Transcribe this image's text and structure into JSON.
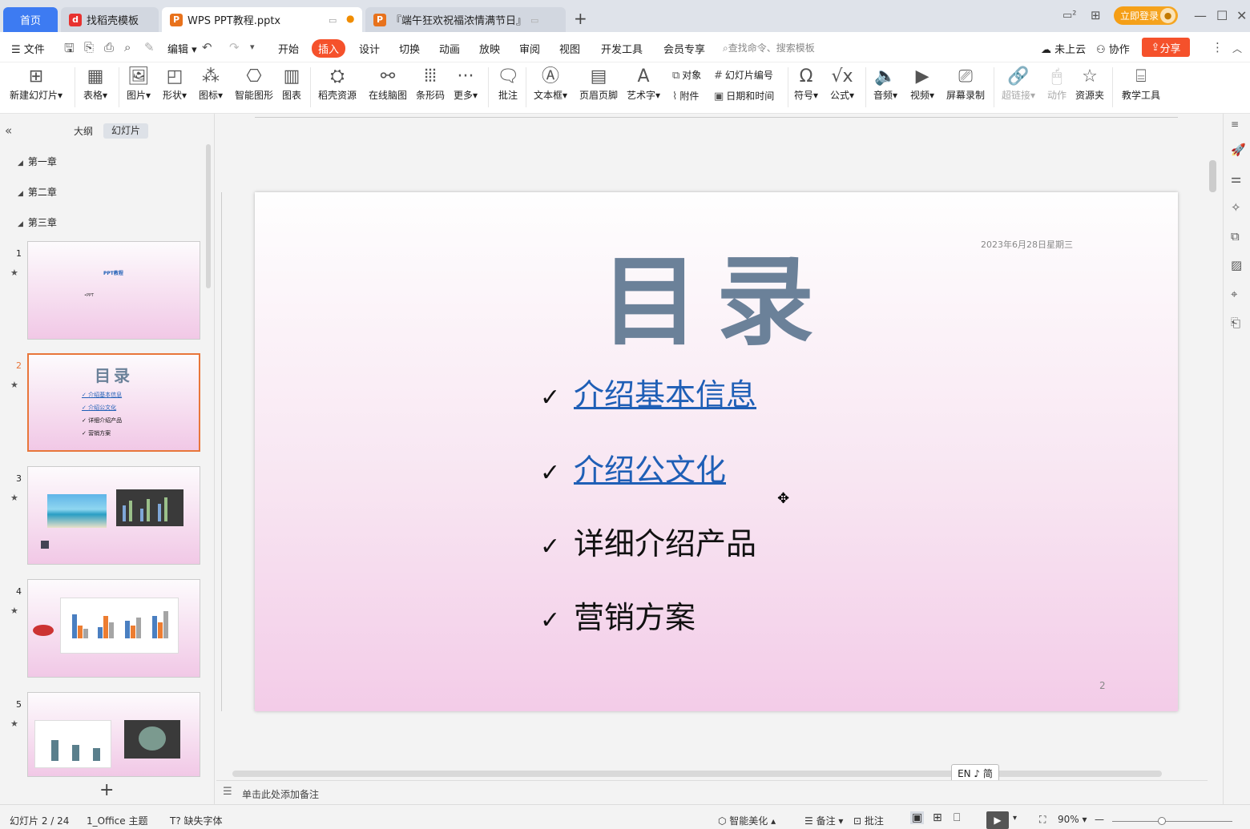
{
  "tabs": {
    "home": "首页",
    "template": "找稻壳模板",
    "ppt": "WPS PPT教程.pptx",
    "festival": "『端午狂欢祝福浓情满节日』"
  },
  "titlebar": {
    "login": "立即登录"
  },
  "menu": {
    "file": "文件",
    "edit": "编辑",
    "items": [
      "开始",
      "插入",
      "设计",
      "切换",
      "动画",
      "放映",
      "审阅",
      "视图",
      "开发工具",
      "会员专享"
    ],
    "search_placeholder": "查找命令、搜索模板",
    "cloud": "未上云",
    "collab": "协作",
    "share": "分享"
  },
  "ribbon": {
    "new_slide": "新建幻灯片",
    "table": "表格",
    "picture": "图片",
    "shape": "形状",
    "icon": "图标",
    "smartart": "智能图形",
    "chart": "图表",
    "docer": "稻壳资源",
    "mindmap": "在线脑图",
    "barcode": "条形码",
    "more": "更多",
    "comment": "批注",
    "textbox": "文本框",
    "header_footer": "页眉页脚",
    "wordart": "艺术字",
    "object": "对象",
    "attachment": "附件",
    "slide_number": "幻灯片编号",
    "datetime": "日期和时间",
    "symbol": "符号",
    "formula": "公式",
    "audio": "音频",
    "video": "视频",
    "screen_record": "屏幕录制",
    "hyperlink": "超链接",
    "action": "动作",
    "resource_folder": "资源夹",
    "teaching_tools": "教学工具"
  },
  "left_panel": {
    "outline_tab": "大纲",
    "slides_tab": "幻灯片",
    "chapters": [
      "第一章",
      "第二章",
      "第三章"
    ],
    "slide_numbers": [
      "1",
      "2",
      "3",
      "4",
      "5"
    ],
    "thumb1_title": "PPT教程",
    "thumb1_sub": "•PPT",
    "thumb2_title": "目录",
    "thumb2_items": [
      "介绍基本信息",
      "介绍公文化",
      "详细介绍产品",
      "营销方案"
    ]
  },
  "slide": {
    "title": "目录",
    "date": "2023年6月28日星期三",
    "bullets": [
      "介绍基本信息",
      "介绍公文化",
      "详细介绍产品",
      "营销方案"
    ],
    "check": "✓",
    "page_number": "2"
  },
  "notes": {
    "placeholder": "单击此处添加备注"
  },
  "ime": "EN ♪ 简",
  "statusbar": {
    "slide_info": "幻灯片 2 / 24",
    "theme": "1_Office 主题",
    "missing_font": "缺失字体",
    "beautify": "智能美化",
    "notes": "备注",
    "comment": "批注",
    "zoom": "90%"
  },
  "colors": {
    "accent": "#f5512b",
    "home_tab": "#3d7bf2",
    "title": "#6b8199",
    "link": "#1f5fb6"
  }
}
